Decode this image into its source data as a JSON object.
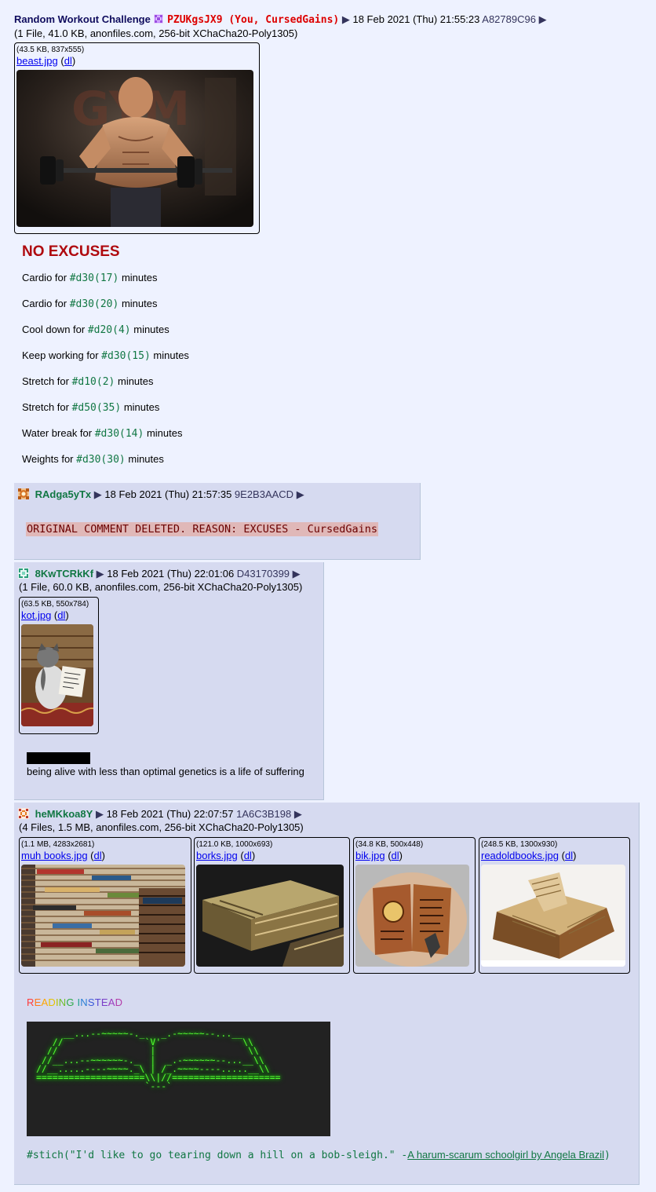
{
  "op": {
    "subject": "Random Workout Challenge",
    "name": "PZUKgsJX9 (You, CursedGains)",
    "arrow": "▶",
    "date": "18 Feb 2021 (Thu) 21:55:23",
    "post_id": "A82789C96",
    "file_summary": "(1 File, 41.0 KB, anonfiles.com, 256-bit XChaCha20-Poly1305)",
    "file": {
      "meta": "(43.5 KB, 837x555)",
      "filename": "beast.jpg",
      "dl_open": "(",
      "dl": "dl",
      "dl_close": ")"
    },
    "heading": "NO EXCUSES",
    "rolls": [
      {
        "pre": "Cardio for ",
        "roll": "#d30(17)",
        "post": " minutes"
      },
      {
        "pre": "Cardio for ",
        "roll": "#d30(20)",
        "post": " minutes"
      },
      {
        "pre": "Cool down for ",
        "roll": "#d20(4)",
        "post": " minutes"
      },
      {
        "pre": "Keep working for ",
        "roll": "#d30(15)",
        "post": " minutes"
      },
      {
        "pre": "Stretch for ",
        "roll": "#d10(2)",
        "post": " minutes"
      },
      {
        "pre": "Stretch for ",
        "roll": "#d50(35)",
        "post": " minutes"
      },
      {
        "pre": "Water break for ",
        "roll": "#d30(14)",
        "post": " minutes"
      },
      {
        "pre": "Weights for ",
        "roll": "#d30(30)",
        "post": " minutes"
      }
    ]
  },
  "reply1": {
    "name": "RAdga5yTx",
    "arrow": "▶",
    "date": "18 Feb 2021 (Thu) 21:57:35",
    "post_id": "9E2B3AACD",
    "deleted": "ORIGINAL COMMENT DELETED. REASON: EXCUSES - CursedGains"
  },
  "reply2": {
    "name": "8KwTCRkKf",
    "arrow": "▶",
    "date": "18 Feb 2021 (Thu) 22:01:06",
    "post_id": "D43170399",
    "file_summary": "(1 File, 60.0 KB, anonfiles.com, 256-bit XChaCha20-Poly1305)",
    "file": {
      "meta": "(63.5 KB, 550x784)",
      "filename": "kot.jpg",
      "dl": "dl"
    },
    "text": "being alive with less than optimal genetics is a life of suffering"
  },
  "reply3": {
    "name": "heMKkoa8Y",
    "arrow": "▶",
    "date": "18 Feb 2021 (Thu) 22:07:57",
    "post_id": "1A6C3B198",
    "file_summary": "(4 Files, 1.5 MB, anonfiles.com, 256-bit XChaCha20-Poly1305)",
    "files": [
      {
        "meta": "(1.1 MB, 4283x2681)",
        "filename": "muh books.jpg",
        "dl": "dl"
      },
      {
        "meta": "(121.0 KB, 1000x693)",
        "filename": "borks.jpg",
        "dl": "dl"
      },
      {
        "meta": "(34.8 KB, 500x448)",
        "filename": "bik.jpg",
        "dl": "dl"
      },
      {
        "meta": "(248.5 KB, 1300x930)",
        "filename": "readoldbooks.jpg",
        "dl": "dl"
      }
    ],
    "rainbow_text": "READING INSTEAD",
    "rainbow_colors": [
      "#ff3b3b",
      "#ff7a1a",
      "#ffa500",
      "#e6c200",
      "#b5c400",
      "#6fbf2a",
      "#2eaa4a",
      "#1f9f8f",
      "#2a7fd4",
      "#3b5bd9",
      "#5a45d0",
      "#7b3fc8",
      "#9a3bbf",
      "#b33aa8",
      "#c8388f"
    ],
    "ascii_art": "     __...--~~~~~-._   _.-~~~~~--...__\n   //               `V'               \\\\\n  //                 |                 \\\\\n //__...--~~~~~~-._  |  _.-~~~~~~--...__\\\\\n//__.....----~~~~._\\ | /_.~~~~----.....__\\\\\n====================\\\\|//====================\n                    `---`",
    "stich_prefix": "#stich(\"I'd like to go tearing down a hill on a bob-sleigh.\" -",
    "stich_link": "A harum-scarum schoolgirl by Angela Brazil",
    "stich_suffix": ")"
  }
}
